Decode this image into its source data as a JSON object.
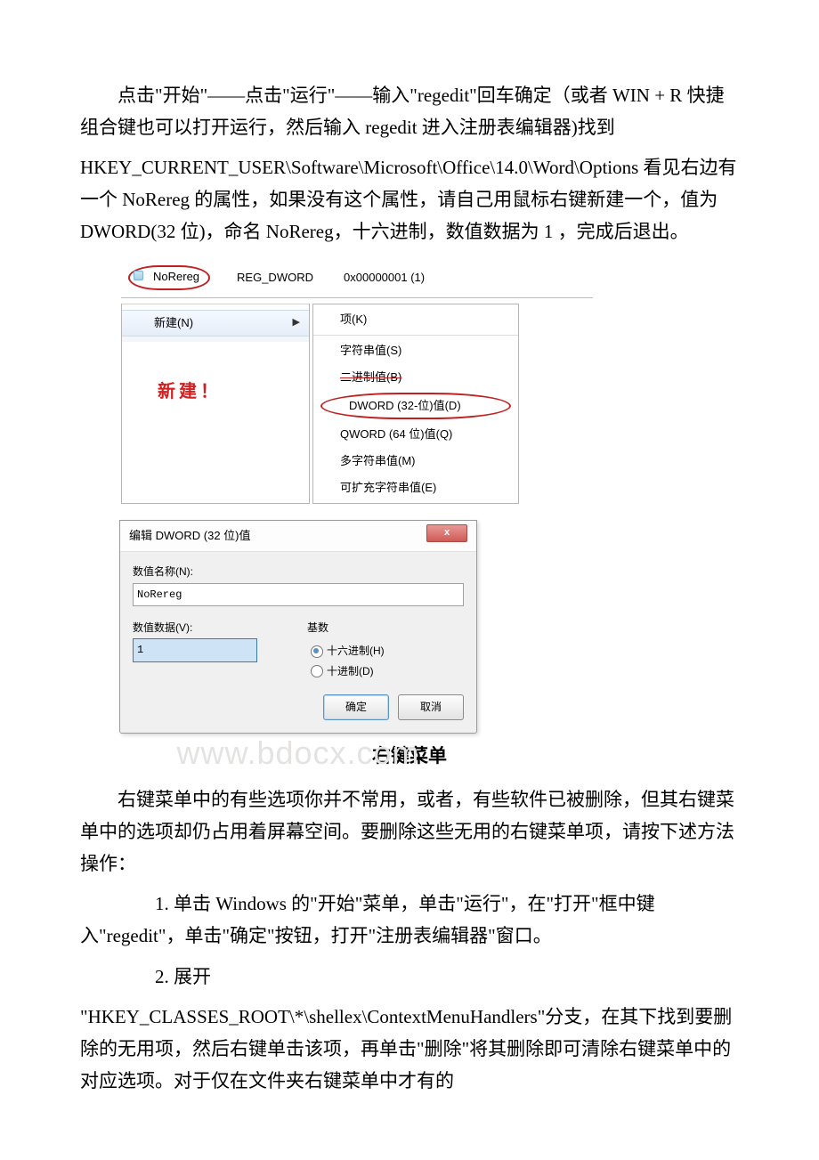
{
  "doc": {
    "p1": "点击\"开始\"——点击\"运行\"——输入\"regedit\"回车确定（或者 WIN +  R  快捷组合键也可以打开运行，然后输入 regedit 进入注册表编辑器)找到",
    "p1b": "HKEY_CURRENT_USER\\Software\\Microsoft\\Office\\14.0\\Word\\Options 看见右边有一个 NoRereg 的属性，如果没有这个属性，请自己用鼠标右键新建一个，值为 DWORD(32 位)，命名 NoRereg，十六进制，数值数据为 1 ，完成后退出。",
    "heading": "右键菜单",
    "p2": "右键菜单中的有些选项你并不常用，或者，有些软件已被删除，但其右键菜单中的选项却仍占用着屏幕空间。要删除这些无用的右键菜单项，请按下述方法操作：",
    "p3": "1. 单击 Windows 的\"开始\"菜单，单击\"运行\"，在\"打开\"框中键入\"regedit\"，单击\"确定\"按钮，打开\"注册表编辑器\"窗口。",
    "p4": "2. 展开",
    "p5": "\"HKEY_CLASSES_ROOT\\*\\shellex\\ContextMenuHandlers\"分支，在其下找到要删除的无用项，然后右键单击该项，再单击\"删除\"将其删除即可清除右键菜单中的对应选项。对于仅在文件夹右键菜单中才有的"
  },
  "reg": {
    "name": "NoRereg",
    "type": "REG_DWORD",
    "value": "0x00000001 (1)"
  },
  "menu_left": {
    "new": "新建(N)"
  },
  "menu_right": {
    "key": "项(K)",
    "string": "字符串值(S)",
    "binary": "二进制值(B)",
    "dword": "DWORD (32-位)值(D)",
    "qword": "QWORD (64 位)值(Q)",
    "multi": "多字符串值(M)",
    "expand": "可扩充字符串值(E)"
  },
  "new_label": "新建！",
  "dialog": {
    "title": "编辑 DWORD (32 位)值",
    "name_label": "数值名称(N):",
    "name_value": "NoRereg",
    "data_label": "数值数据(V):",
    "data_value": "1",
    "base_label": "基数",
    "radix_hex": "十六进制(H)",
    "radix_dec": "十进制(D)",
    "ok": "确定",
    "cancel": "取消",
    "close": "x"
  },
  "watermark": "www.bdocx.com"
}
